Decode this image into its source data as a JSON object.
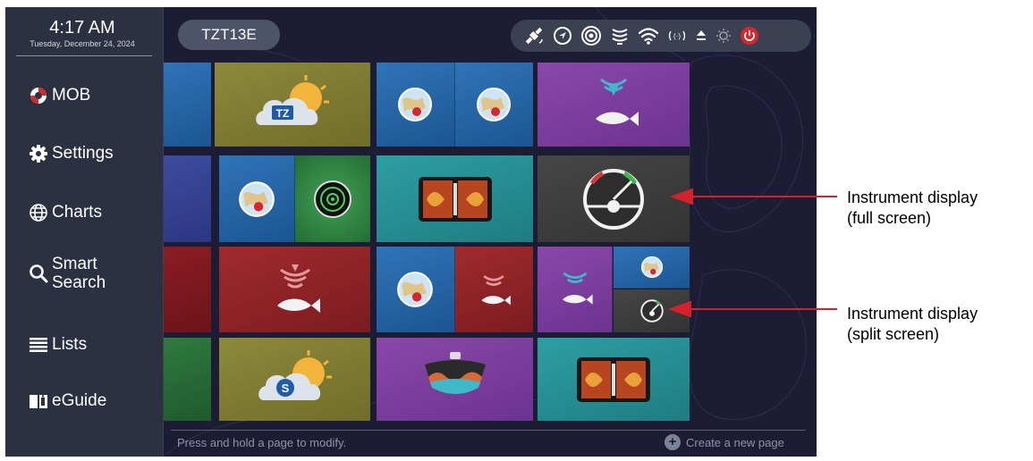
{
  "sidebar": {
    "time": "4:17 AM",
    "date": "Tuesday, December 24, 2024",
    "items": [
      {
        "label": "MOB",
        "icon": "lifebuoy-icon"
      },
      {
        "label": "Settings",
        "icon": "gear-icon"
      },
      {
        "label": "Charts",
        "icon": "globe-icon"
      },
      {
        "label_line1": "Smart",
        "label_line2": "Search",
        "icon": "search-icon"
      },
      {
        "label": "Lists",
        "icon": "list-icon"
      },
      {
        "label": "eGuide",
        "icon": "book-icon"
      }
    ]
  },
  "header": {
    "model": "TZT13E",
    "status_icons": [
      "satellite-icon",
      "navigation-icon",
      "radar-icon",
      "fish-finder-icon",
      "wifi-icon",
      "signal-icon",
      "connection-icon",
      "brightness-icon",
      "power-icon"
    ]
  },
  "tiles": [
    {
      "row": 1,
      "col": 0,
      "panes": [
        "blue"
      ]
    },
    {
      "row": 1,
      "col": 1,
      "panes": [
        "timezero"
      ]
    },
    {
      "row": 1,
      "col": 2,
      "panes": [
        "chart",
        "chart"
      ]
    },
    {
      "row": 1,
      "col": 3,
      "panes": [
        "fishfinder-purple"
      ]
    },
    {
      "row": 2,
      "col": 0,
      "panes": [
        "indigo"
      ]
    },
    {
      "row": 2,
      "col": 1,
      "panes": [
        "chart",
        "radar"
      ]
    },
    {
      "row": 2,
      "col": 2,
      "panes": [
        "sonar"
      ]
    },
    {
      "row": 2,
      "col": 3,
      "panes": [
        "instrument"
      ]
    },
    {
      "row": 3,
      "col": 0,
      "panes": [
        "darkred"
      ]
    },
    {
      "row": 3,
      "col": 1,
      "panes": [
        "fishfinder-red"
      ]
    },
    {
      "row": 3,
      "col": 2,
      "panes": [
        "chart",
        "fishfinder-red"
      ]
    },
    {
      "row": 3,
      "col": 3,
      "panes": [
        "split-instrument"
      ]
    },
    {
      "row": 4,
      "col": 0,
      "panes": [
        "darkgreen"
      ]
    },
    {
      "row": 4,
      "col": 1,
      "panes": [
        "smart-app"
      ]
    },
    {
      "row": 4,
      "col": 2,
      "panes": [
        "3d-sounder"
      ]
    },
    {
      "row": 4,
      "col": 3,
      "panes": [
        "sonar"
      ]
    }
  ],
  "footer": {
    "hint": "Press and hold a page to modify.",
    "create": "Create a new page"
  },
  "callouts": [
    {
      "line1": "Instrument display",
      "line2": "(full screen)"
    },
    {
      "line1": "Instrument display",
      "line2": "(split screen)"
    }
  ],
  "colors": {
    "background": "#1d1c35",
    "sidebar": "#2b3140",
    "callout_arrow": "#d8202a"
  }
}
